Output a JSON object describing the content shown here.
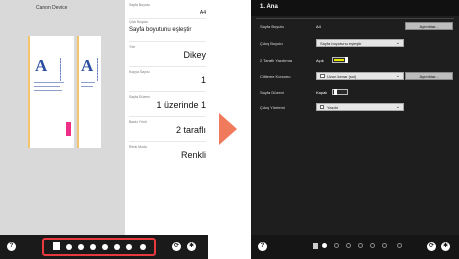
{
  "left_screen": {
    "device_title": "Canon Device",
    "settings": [
      {
        "label": "Sayfa Boyutu",
        "value": "A4"
      },
      {
        "label": "Çıktı Boyutu",
        "value": "Sayfa boyutunu eşleştir"
      },
      {
        "label": "Yön",
        "value": "Dikey"
      },
      {
        "label": "Kopya Sayısı",
        "value": "1"
      },
      {
        "label": "Sayfa Düzeni",
        "value": "1 üzerinde 1"
      },
      {
        "label": "Baskı Yönü",
        "value": "2 taraflı"
      },
      {
        "label": "Renk Modu",
        "value": "Renkli"
      }
    ],
    "preview_glyph": "A",
    "help_icon_glyph": "?",
    "nav_page_count": 7
  },
  "right_screen": {
    "section_title": "1. Ana",
    "rows": {
      "paper_size": {
        "label": "Sayfa Boyutu",
        "value": "A4",
        "button": "Ayrıntılar..."
      },
      "output_size": {
        "label": "Çıkış Boyutu",
        "value": "Sayfa boyutunu eşleştir"
      },
      "duplex": {
        "label": "2 Taraflı Yazdırma",
        "value": "Açık",
        "on": true
      },
      "staple": {
        "label": "Ciltleme Konumu",
        "value": "Uzun kenar (sol)",
        "button": "Ayrıntılar..."
      },
      "page_layout": {
        "label": "Sayfa Düzeni",
        "value": "Kapalı",
        "on": false
      },
      "output_dest": {
        "label": "Çıkış Yöntemi",
        "value": "Yazdır"
      }
    },
    "help_icon_glyph": "?",
    "nav_page_count": 7,
    "active_page": 1
  },
  "colors": {
    "accent_yellow": "#e6e600",
    "highlight_red": "#e8393f",
    "arrow": "#f07a5c",
    "pink": "#ee2f87",
    "preview_blue": "#2b4fa0"
  }
}
